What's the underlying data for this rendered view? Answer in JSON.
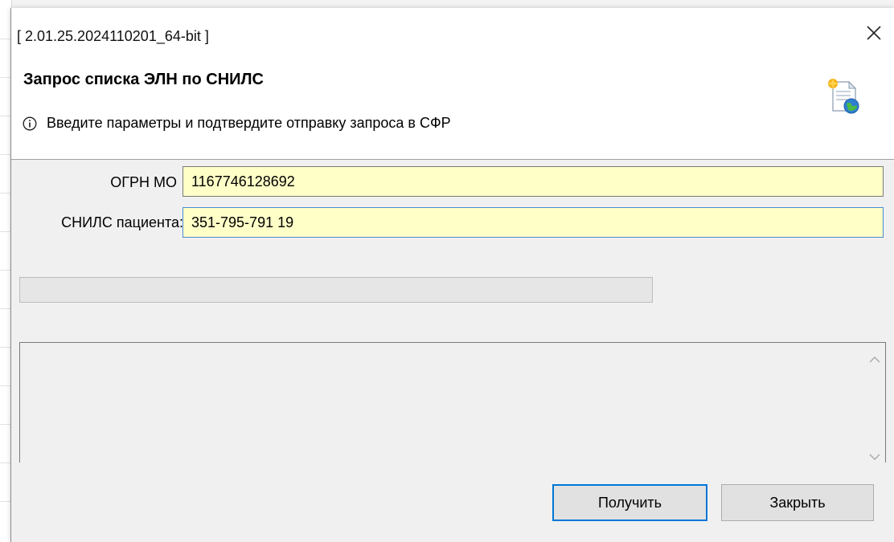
{
  "window": {
    "title": "[ 2.01.25.2024110201_64-bit ]",
    "close_icon": "close-icon"
  },
  "header": {
    "title": "Запрос списка ЭЛН по СНИЛС",
    "message": "Введите параметры и подтвердите отправку запроса в СФР",
    "info_icon": "info-icon",
    "wizard_icon": "document-globe-icon"
  },
  "form": {
    "ogrn_label": "ОГРН МО",
    "ogrn_value": "1167746128692",
    "snils_label": "СНИЛС пациента:",
    "snils_value": "351-795-791 19"
  },
  "progress": {
    "value": 0
  },
  "log": {
    "text": ""
  },
  "buttons": {
    "get_label": "Получить",
    "close_label": "Закрыть"
  },
  "colors": {
    "field_bg": "#ffffc8",
    "focus_border": "#0078d7"
  }
}
